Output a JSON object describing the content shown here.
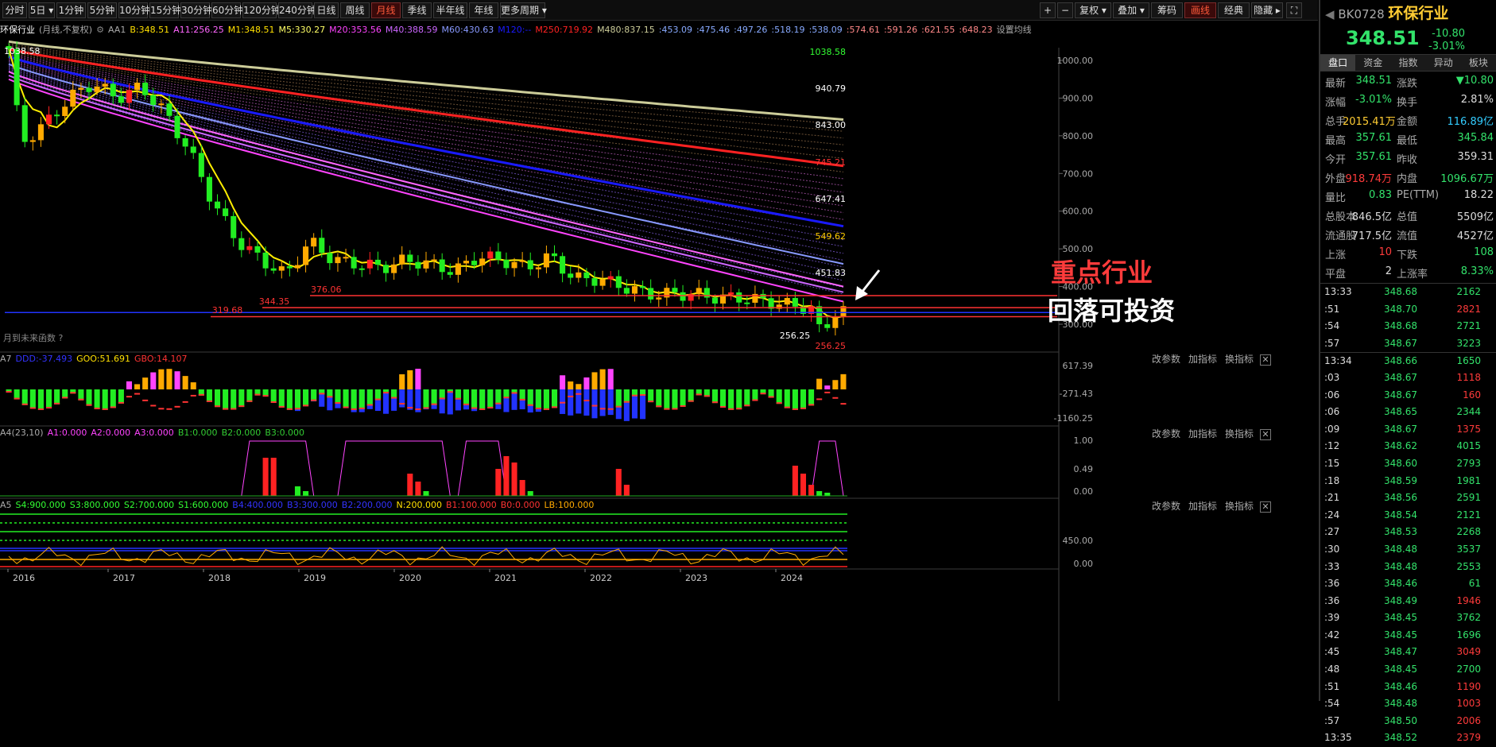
{
  "toolbar": {
    "periods": [
      "分时",
      "5日",
      "1分钟",
      "5分钟",
      "10分钟",
      "15分钟",
      "30分钟",
      "60分钟",
      "120分钟",
      "240分钟",
      "日线",
      "周线",
      "月线",
      "季线",
      "半年线",
      "年线",
      "更多周期"
    ],
    "active_period": "月线",
    "right_buttons": [
      "复权",
      "叠加",
      "筹码",
      "画线",
      "经典",
      "隐藏"
    ],
    "active_right": "画线"
  },
  "legend": {
    "name": "环保行业",
    "mode": "(月线,不复权)",
    "indicator": "AA1",
    "items": [
      {
        "text": "B:348.51",
        "color": "#ffe000"
      },
      {
        "text": "A11:256.25",
        "color": "#ff66ff"
      },
      {
        "text": "M1:348.51",
        "color": "#ffe000"
      },
      {
        "text": "M5:330.27",
        "color": "#ffff66"
      },
      {
        "text": "M20:353.56",
        "color": "#ff44ff"
      },
      {
        "text": "M40:388.59",
        "color": "#cc66ff"
      },
      {
        "text": "M60:430.63",
        "color": "#8899ff"
      },
      {
        "text": "M120:--",
        "color": "#1a1aff"
      },
      {
        "text": "M250:719.92",
        "color": "#ff2222"
      },
      {
        "text": "M480:837.15",
        "color": "#cccc99"
      },
      {
        "text": ":453.09",
        "color": "#88aaff"
      },
      {
        "text": ":475.46",
        "color": "#88aaff"
      },
      {
        "text": ":497.26",
        "color": "#88aaff"
      },
      {
        "text": ":518.19",
        "color": "#88aaff"
      },
      {
        "text": ":538.09",
        "color": "#88aaff"
      },
      {
        "text": ":574.61",
        "color": "#ff8888"
      },
      {
        "text": ":591.26",
        "color": "#ff8888"
      },
      {
        "text": ":621.55",
        "color": "#ff8888"
      },
      {
        "text": ":648.23",
        "color": "#ff8888"
      },
      {
        "text": "设置均线",
        "color": "#aaaaaa"
      }
    ],
    "future_label": "月到未来函数"
  },
  "main_axis": {
    "y_ticks": [
      "1000.00",
      "900.00",
      "800.00",
      "700.00",
      "600.00",
      "500.00",
      "400.00",
      "300.00"
    ],
    "price_marks": [
      {
        "label": "1038.58",
        "color": "#33ff33"
      },
      {
        "label": "940.79",
        "color": "#ffffff"
      },
      {
        "label": "843.00",
        "color": "#ffffff"
      },
      {
        "label": "745.21",
        "color": "#ff3333"
      },
      {
        "label": "647.41",
        "color": "#ffffff"
      },
      {
        "label": "549.62",
        "color": "#ffcc00"
      },
      {
        "label": "451.83",
        "color": "#ffffff"
      },
      {
        "label": "256.25",
        "color": "#ff3333"
      }
    ],
    "chart_labels": [
      "1038.58",
      "376.06",
      "344.35",
      "319.68",
      "256.25"
    ],
    "x_ticks": [
      "2016",
      "2017",
      "2018",
      "2019",
      "2020",
      "2021",
      "2022",
      "2023",
      "2024"
    ]
  },
  "notes": {
    "line1": "重点行业",
    "line2": "回落可投资"
  },
  "sub_a7": {
    "prefix": "A7",
    "items": [
      {
        "text": "DDD:-37.493",
        "color": "#3333ff"
      },
      {
        "text": "GOO:51.691",
        "color": "#ffe000"
      },
      {
        "text": "GBO:14.107",
        "color": "#ff3333"
      }
    ],
    "y_ticks": [
      "617.39",
      "-271.43",
      "-1160.25"
    ]
  },
  "sub_a4": {
    "prefix": "A4(23,10)",
    "items": [
      {
        "text": "A1:0.000",
        "color": "#ff44ff"
      },
      {
        "text": "A2:0.000",
        "color": "#ff44ff"
      },
      {
        "text": "A3:0.000",
        "color": "#ff44ff"
      },
      {
        "text": "B1:0.000",
        "color": "#33cc33"
      },
      {
        "text": "B2:0.000",
        "color": "#33cc33"
      },
      {
        "text": "B3:0.000",
        "color": "#33cc33"
      }
    ],
    "y_ticks": [
      "1.00",
      "0.49",
      "0.00"
    ]
  },
  "sub_a5": {
    "prefix": "A5",
    "items": [
      {
        "text": "S4:900.000",
        "color": "#33ff33"
      },
      {
        "text": "S3:800.000",
        "color": "#33ff33"
      },
      {
        "text": "S2:700.000",
        "color": "#33ff33"
      },
      {
        "text": "S1:600.000",
        "color": "#33ff33"
      },
      {
        "text": "B4:400.000",
        "color": "#3333ff"
      },
      {
        "text": "B3:300.000",
        "color": "#3333ff"
      },
      {
        "text": "B2:200.000",
        "color": "#3333ff"
      },
      {
        "text": "N:200.000",
        "color": "#ffe000"
      },
      {
        "text": "B1:100.000",
        "color": "#ff3333"
      },
      {
        "text": "B0:0.000",
        "color": "#ff3333"
      },
      {
        "text": "LB:100.000",
        "color": "#ffaa00"
      }
    ],
    "y_ticks": [
      "450.00",
      "0.00"
    ]
  },
  "sub_controls": {
    "params": "改参数",
    "add": "加指标",
    "swap": "换指标"
  },
  "panel": {
    "code": "BK0728",
    "name": "环保行业",
    "price": "348.51",
    "change": "-10.80",
    "change_pct": "-3.01%",
    "tabs": [
      "盘口",
      "资金",
      "指数",
      "异动",
      "板块"
    ],
    "active_tab": "盘口",
    "quote_rows": [
      [
        {
          "l": "最新",
          "v": "348.51",
          "c": "#33e36b"
        },
        {
          "l": "涨跌",
          "v": "▼10.80",
          "c": "#33e36b"
        }
      ],
      [
        {
          "l": "涨幅",
          "v": "-3.01%",
          "c": "#33e36b"
        },
        {
          "l": "换手",
          "v": "2.81%",
          "c": "#dddddd"
        }
      ],
      [
        {
          "l": "总手",
          "v": "2015.41万",
          "c": "#ffcc33"
        },
        {
          "l": "金额",
          "v": "116.89亿",
          "c": "#33ccff"
        }
      ],
      [
        {
          "l": "最高",
          "v": "357.61",
          "c": "#33e36b"
        },
        {
          "l": "最低",
          "v": "345.84",
          "c": "#33e36b"
        }
      ],
      [
        {
          "l": "今开",
          "v": "357.61",
          "c": "#33e36b"
        },
        {
          "l": "昨收",
          "v": "359.31",
          "c": "#dddddd"
        }
      ],
      [
        {
          "l": "外盘",
          "v": "918.74万",
          "c": "#ff3b3b"
        },
        {
          "l": "内盘",
          "v": "1096.67万",
          "c": "#33e36b"
        }
      ],
      [
        {
          "l": "量比",
          "v": "0.83",
          "c": "#33e36b"
        },
        {
          "l": "PE(TTM)",
          "v": "18.22",
          "c": "#dddddd"
        }
      ],
      [
        {
          "l": "总股本",
          "v": "846.5亿",
          "c": "#dddddd"
        },
        {
          "l": "总值",
          "v": "5509亿",
          "c": "#dddddd"
        }
      ],
      [
        {
          "l": "流通股",
          "v": "717.5亿",
          "c": "#dddddd"
        },
        {
          "l": "流值",
          "v": "4527亿",
          "c": "#dddddd"
        }
      ],
      [
        {
          "l": "上涨",
          "v": "10",
          "c": "#ff3b3b"
        },
        {
          "l": "下跌",
          "v": "108",
          "c": "#33e36b"
        }
      ],
      [
        {
          "l": "平盘",
          "v": "2",
          "c": "#dddddd"
        },
        {
          "l": "上涨率",
          "v": "8.33%",
          "c": "#33e36b"
        }
      ]
    ],
    "ticks": [
      {
        "t": "13:33",
        "p": "348.68",
        "v": "2162",
        "c": "#33e36b"
      },
      {
        "t": ":51",
        "p": "348.70",
        "v": "2821",
        "c": "#ff3b3b"
      },
      {
        "t": ":54",
        "p": "348.68",
        "v": "2721",
        "c": "#33e36b"
      },
      {
        "t": ":57",
        "p": "348.67",
        "v": "3223",
        "c": "#33e36b"
      },
      {
        "t": "13:34",
        "p": "348.66",
        "v": "1650",
        "c": "#33e36b"
      },
      {
        "t": ":03",
        "p": "348.67",
        "v": "1118",
        "c": "#ff3b3b"
      },
      {
        "t": ":06",
        "p": "348.67",
        "v": "160",
        "c": "#ff3b3b"
      },
      {
        "t": ":06",
        "p": "348.65",
        "v": "2344",
        "c": "#33e36b"
      },
      {
        "t": ":09",
        "p": "348.67",
        "v": "1375",
        "c": "#ff3b3b"
      },
      {
        "t": ":12",
        "p": "348.62",
        "v": "4015",
        "c": "#33e36b"
      },
      {
        "t": ":15",
        "p": "348.60",
        "v": "2793",
        "c": "#33e36b"
      },
      {
        "t": ":18",
        "p": "348.59",
        "v": "1981",
        "c": "#33e36b"
      },
      {
        "t": ":21",
        "p": "348.56",
        "v": "2591",
        "c": "#33e36b"
      },
      {
        "t": ":24",
        "p": "348.54",
        "v": "2121",
        "c": "#33e36b"
      },
      {
        "t": ":27",
        "p": "348.53",
        "v": "2268",
        "c": "#33e36b"
      },
      {
        "t": ":30",
        "p": "348.48",
        "v": "3537",
        "c": "#33e36b"
      },
      {
        "t": ":33",
        "p": "348.48",
        "v": "2553",
        "c": "#33e36b"
      },
      {
        "t": ":36",
        "p": "348.46",
        "v": "61",
        "c": "#33e36b"
      },
      {
        "t": ":36",
        "p": "348.49",
        "v": "1946",
        "c": "#ff3b3b"
      },
      {
        "t": ":39",
        "p": "348.45",
        "v": "3762",
        "c": "#33e36b"
      },
      {
        "t": ":42",
        "p": "348.45",
        "v": "1696",
        "c": "#33e36b"
      },
      {
        "t": ":45",
        "p": "348.47",
        "v": "3049",
        "c": "#ff3b3b"
      },
      {
        "t": ":48",
        "p": "348.45",
        "v": "2700",
        "c": "#33e36b"
      },
      {
        "t": ":51",
        "p": "348.46",
        "v": "1190",
        "c": "#ff3b3b"
      },
      {
        "t": ":54",
        "p": "348.48",
        "v": "1003",
        "c": "#ff3b3b"
      },
      {
        "t": ":57",
        "p": "348.50",
        "v": "2006",
        "c": "#ff3b3b"
      },
      {
        "t": "13:35",
        "p": "348.52",
        "v": "2379",
        "c": "#ff3b3b"
      }
    ]
  }
}
